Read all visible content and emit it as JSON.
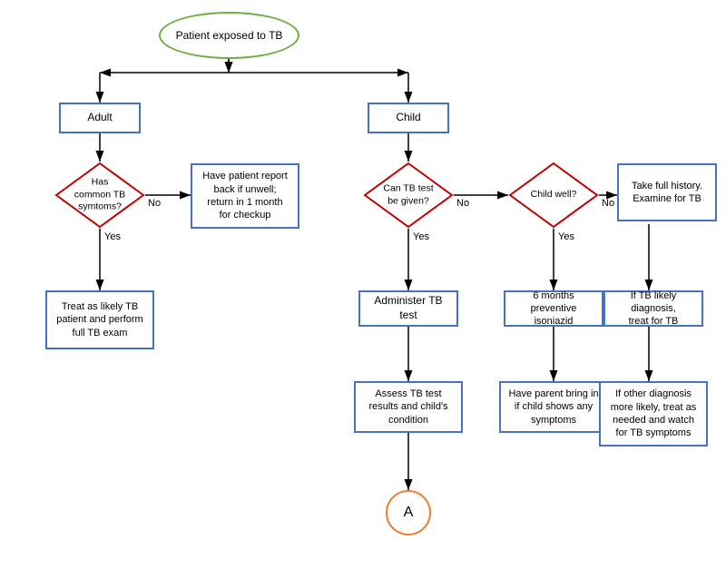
{
  "nodes": {
    "start": {
      "label": "Patient exposed to TB"
    },
    "adult": {
      "label": "Adult"
    },
    "child": {
      "label": "Child"
    },
    "diamond1": {
      "label": "Has\ncommon TB\nsymtoms?"
    },
    "report_back": {
      "label": "Have patient report\nback if unwell;\nreturn in 1 month\nfor checkup"
    },
    "treat_adult": {
      "label": "Treat as likely TB\npatient and perform\nfull TB exam"
    },
    "diamond2": {
      "label": "Can TB test\nbe given?"
    },
    "diamond3": {
      "label": "Child well?"
    },
    "full_history": {
      "label": "Take full history.\nExamine for TB"
    },
    "administer": {
      "label": "Administer TB test"
    },
    "preventive": {
      "label": "6 months\npreventive isoniazid"
    },
    "if_tb_likely": {
      "label": "If TB likely diagnosis,\ntreat for TB"
    },
    "assess": {
      "label": "Assess TB test\nresults and child's\ncondition"
    },
    "parent_bring": {
      "label": "Have parent bring in\nif child shows any\nsymptoms"
    },
    "other_diagnosis": {
      "label": "If other diagnosis\nmore likely, treat as\nneeded and watch\nfor TB symptoms"
    },
    "connector_a": {
      "label": "A"
    }
  },
  "labels": {
    "no1": "No",
    "yes1": "Yes",
    "no2": "No",
    "yes2": "Yes",
    "no3": "No",
    "yes3": "Yes"
  }
}
